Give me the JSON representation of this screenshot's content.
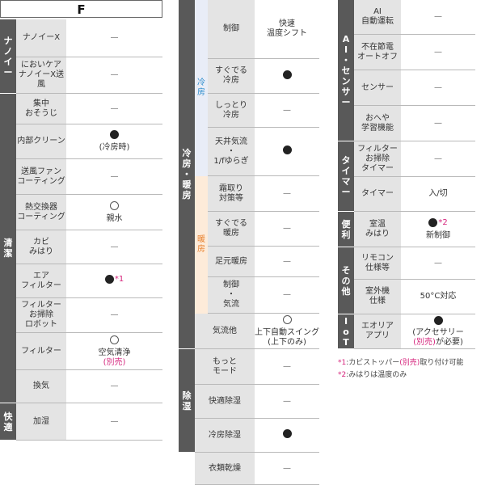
{
  "col1": {
    "header": "F",
    "categories": [
      {
        "label": "ナノイー",
        "rows": [
          0,
          1
        ]
      },
      {
        "label": "清潔",
        "rows": [
          2,
          10
        ]
      },
      {
        "label": "快適",
        "rows": [
          11,
          11
        ]
      }
    ],
    "rows": [
      {
        "label": "ナノイーX",
        "value": "—"
      },
      {
        "label": "においケア\nナノイーX送風",
        "value": "—"
      },
      {
        "label": "集中\nおそうじ",
        "value": "—"
      },
      {
        "label": "内部クリーン",
        "mark": "dot",
        "value": "(冷房時)"
      },
      {
        "label": "送風ファン\nコーティング",
        "value": "—"
      },
      {
        "label": "熱交換器\nコーティング",
        "mark": "circle",
        "value": "親水"
      },
      {
        "label": "カビ\nみはり",
        "value": "—"
      },
      {
        "label": "エア\nフィルター",
        "mark": "dot",
        "star": "*1"
      },
      {
        "label": "フィルター\nお掃除\nロボット",
        "value": "—"
      },
      {
        "label": "フィルター",
        "mark": "circle",
        "value": "空気清浄",
        "pink": "(別売)"
      },
      {
        "label": "換気",
        "value": "—"
      },
      {
        "label": "加湿",
        "value": "—"
      }
    ]
  },
  "col2": {
    "categories": [
      {
        "label": "冷\n房\n・\n暖\n房",
        "rows": [
          0,
          8
        ]
      },
      {
        "label": "除\n湿",
        "rows": [
          9,
          11
        ]
      }
    ],
    "subcats": [
      {
        "label": "冷\n房",
        "rows": [
          0,
          3
        ],
        "color": "#2b8ccc",
        "bg": "#e9edf7"
      },
      {
        "label": "暖\n房",
        "rows": [
          4,
          7
        ],
        "color": "#e8812e",
        "bg": "#fdebd9"
      }
    ],
    "rows": [
      {
        "label": "制御",
        "value": "快速\n温度シフト"
      },
      {
        "label": "すぐでる\n冷房",
        "mark": "dot"
      },
      {
        "label": "しっとり\n冷房",
        "value": "—"
      },
      {
        "label": "天井気流\n・\n1/fゆらぎ",
        "mark": "dot"
      },
      {
        "label": "霜取り\n対策等",
        "value": "—"
      },
      {
        "label": "すぐでる\n暖房",
        "value": "—"
      },
      {
        "label": "足元暖房",
        "value": "—"
      },
      {
        "label": "制御\n・\n気流",
        "value": "—"
      },
      {
        "label": "気流他",
        "mark": "circle",
        "value": "上下自動スイング\n(上下のみ)"
      },
      {
        "label": "もっと\nモード",
        "value": "—"
      },
      {
        "label": "快適除湿",
        "value": "—"
      },
      {
        "label": "冷房除湿",
        "mark": "dot"
      },
      {
        "label": "衣類乾燥",
        "value": "—"
      }
    ]
  },
  "col3": {
    "categories": [
      {
        "label": "A\nI\n・\nセ\nン\nサ\nー",
        "rows": [
          0,
          3
        ]
      },
      {
        "label": "タ\nイ\nマ\nー",
        "rows": [
          4,
          5
        ]
      },
      {
        "label": "便\n利",
        "rows": [
          6,
          6
        ]
      },
      {
        "label": "そ\nの\n他",
        "rows": [
          7,
          8
        ]
      },
      {
        "label": "I\no\nT",
        "rows": [
          9,
          9
        ]
      }
    ],
    "rows": [
      {
        "label": "AI\n自動運転",
        "value": "—"
      },
      {
        "label": "不在節電\nオートオフ",
        "value": "—"
      },
      {
        "label": "センサー",
        "value": "—"
      },
      {
        "label": "おへや\n学習機能",
        "value": "—"
      },
      {
        "label": "フィルター\nお掃除\nタイマー",
        "value": "—"
      },
      {
        "label": "タイマー",
        "value": "入/切"
      },
      {
        "label": "室温\nみはり",
        "mark": "dot",
        "star": "*2",
        "value": "新制御"
      },
      {
        "label": "リモコン\n仕様等",
        "value": "—"
      },
      {
        "label": "室外機\n仕様",
        "value": "50°C対応"
      },
      {
        "label": "エオリア\nアプリ",
        "mark": "dot",
        "value": "(アクセサリー",
        "pink": "(別売)",
        "tail": "が必要)"
      }
    ]
  },
  "notes": [
    {
      "star": "*1",
      "text": ":カビストッパー",
      "pink": "(別売)",
      "tail": "取り付け可能"
    },
    {
      "star": "*2",
      "text": ":みはりは温度のみ"
    }
  ]
}
